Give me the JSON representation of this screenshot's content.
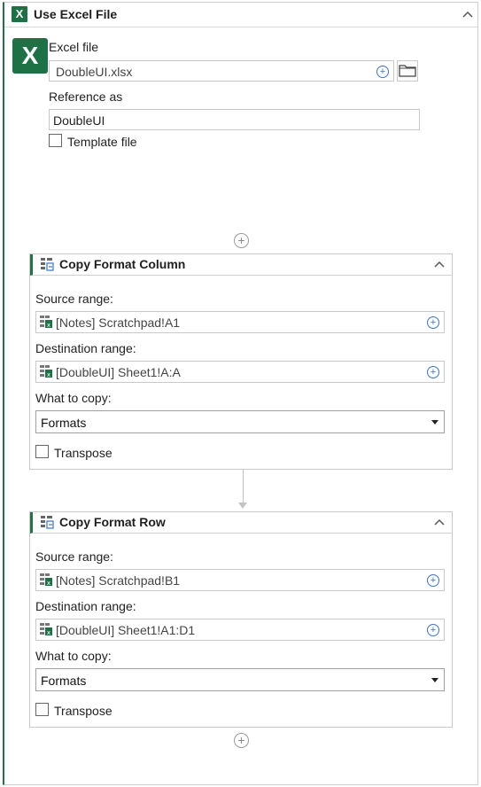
{
  "use_excel": {
    "title": "Use Excel File",
    "badge": "X",
    "big_icon": "X",
    "excel_file_label": "Excel file",
    "excel_file_value": "DoubleUI.xlsx",
    "reference_label": "Reference as",
    "reference_value": "DoubleUI",
    "template_label": "Template file",
    "template_checked": false,
    "brand_color": "#1e7145"
  },
  "copy_column": {
    "title": "Copy Format Column",
    "source_label": "Source range:",
    "source_value": "[Notes] Scratchpad!A1",
    "dest_label": "Destination range:",
    "dest_value": "[DoubleUI] Sheet1!A:A",
    "what_label": "What to copy:",
    "what_value": "Formats",
    "transpose_label": "Transpose",
    "transpose_checked": false
  },
  "copy_row": {
    "title": "Copy Format Row",
    "source_label": "Source range:",
    "source_value": "[Notes] Scratchpad!B1",
    "dest_label": "Destination range:",
    "dest_value": "[DoubleUI] Sheet1!A1:D1",
    "what_label": "What to copy:",
    "what_value": "Formats",
    "transpose_label": "Transpose",
    "transpose_checked": false
  },
  "icons": {
    "collapse": "chevron-up-icon",
    "add": "plus-circle-icon",
    "folder": "folder-icon",
    "range": "excel-range-icon",
    "activity": "copy-format-icon"
  },
  "colors": {
    "accent_blue": "#3a73c9",
    "excel_green": "#217346"
  }
}
